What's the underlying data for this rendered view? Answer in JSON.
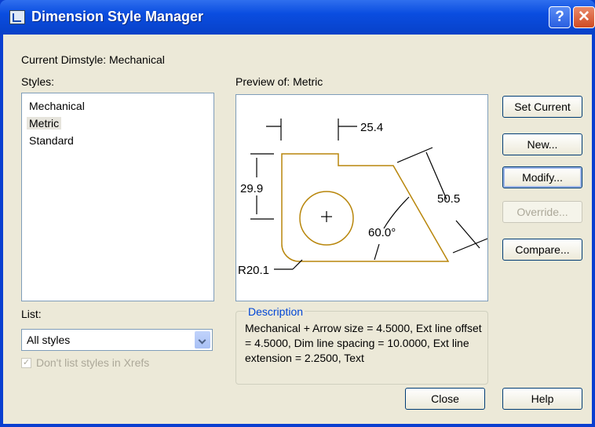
{
  "window": {
    "title": "Dimension Style Manager",
    "help": "?",
    "close": "✕"
  },
  "current_dimstyle": "Current Dimstyle: Mechanical",
  "styles": {
    "label": "Styles:",
    "items": [
      "Mechanical",
      "Metric",
      "Standard"
    ],
    "selected": "Metric"
  },
  "preview": {
    "label": "Preview of: Metric",
    "dims": {
      "d1": "25.4",
      "d2": "29.9",
      "d3": "50.5",
      "d4": "60.0°",
      "d5": "R20.1"
    }
  },
  "list": {
    "label": "List:",
    "value": "All styles"
  },
  "xrefs": {
    "label": "Don't list styles in Xrefs",
    "checked": true
  },
  "description": {
    "title": "Description",
    "text": "Mechanical + Arrow size = 4.5000, Ext line offset = 4.5000, Dim line spacing = 10.0000, Ext line extension = 2.2500, Text"
  },
  "buttons": {
    "set_current": "Set Current",
    "new": "New...",
    "modify": "Modify...",
    "override": "Override...",
    "compare": "Compare...",
    "close": "Close",
    "help": "Help"
  },
  "colors": {
    "titlebar": "#0a4de0",
    "dialog": "#ece9d8",
    "drawing": "#b8860b",
    "group_title": "#0046d5"
  }
}
